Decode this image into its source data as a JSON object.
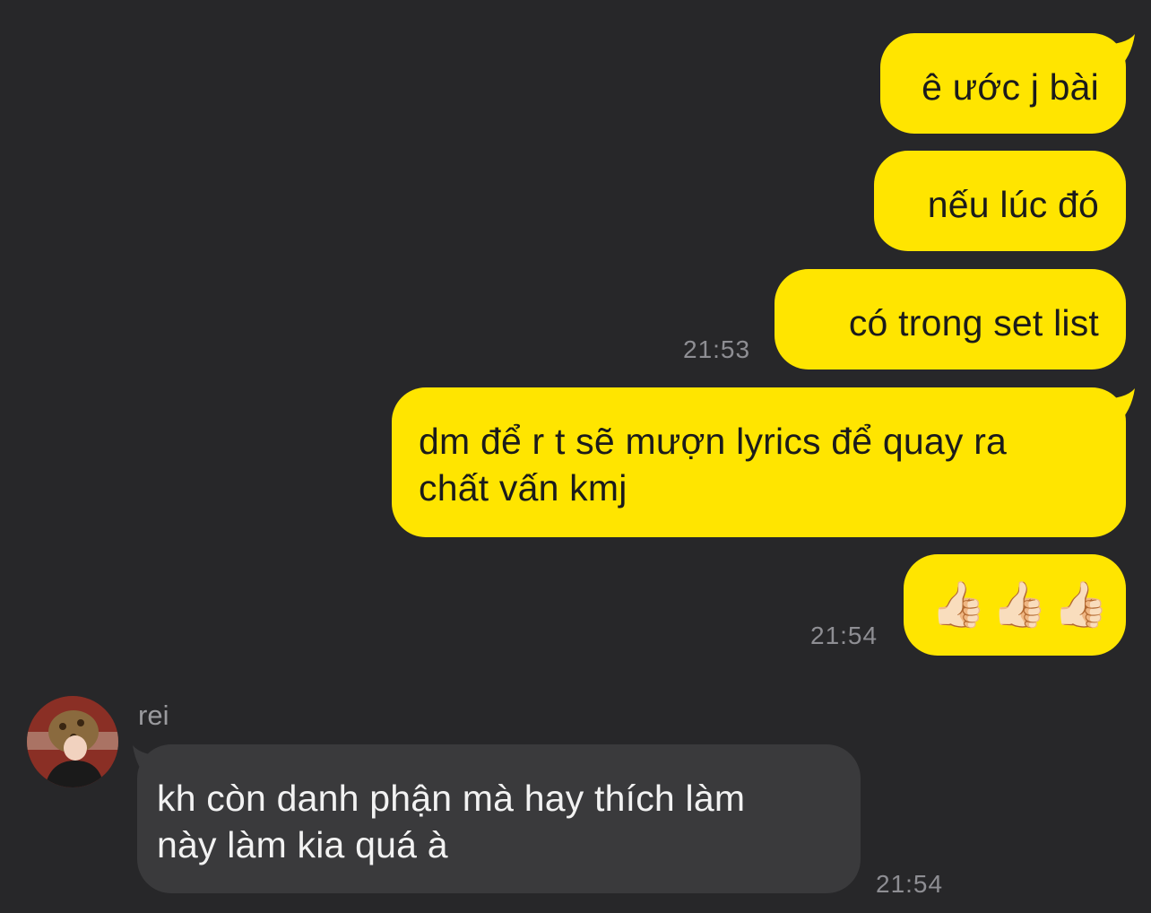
{
  "conversation": {
    "outgoing": [
      {
        "text": "ê ước j bài"
      },
      {
        "text": "nếu lúc đó"
      },
      {
        "text": "có trong set list",
        "time": "21:53"
      },
      {
        "text_line1": "dm để r t sẽ mượn lyrics để quay ra",
        "text_line2": "chất vấn kmj"
      },
      {
        "text": "👍🏻👍🏻👍🏻",
        "time": "21:54"
      }
    ],
    "incoming": [
      {
        "sender": "rei",
        "text_line1": "kh còn danh phận mà hay thích làm",
        "text_line2": "này làm kia quá à",
        "time": "21:54"
      }
    ]
  },
  "colors": {
    "background": "#272729",
    "outgoing_bubble": "#ffe500",
    "incoming_bubble": "#3a3a3c",
    "timestamp": "#8e8e93"
  },
  "icons": {
    "avatar": "user-avatar-photo"
  }
}
